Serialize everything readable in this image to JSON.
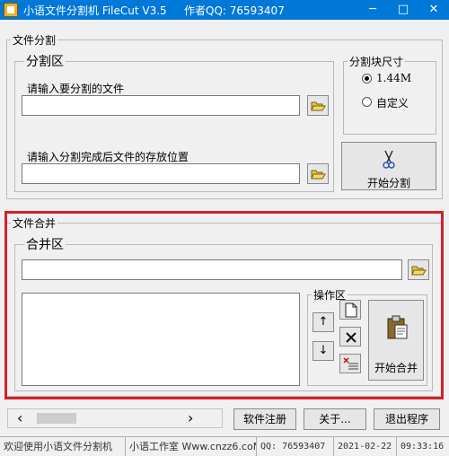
{
  "window": {
    "title": "小语文件分割机 FileCut V3.5",
    "author": "作者QQ: 76593407",
    "minimize_glyph": "─",
    "maximize_glyph": "□",
    "close_glyph": "✕"
  },
  "split": {
    "legend": "文件分割",
    "area_legend": "分割区",
    "source_label": "请输入要分割的文件",
    "source_value": "",
    "dest_label": "请输入分割完成后文件的存放位置",
    "dest_value": "",
    "size_legend": "分割块尺寸",
    "size_options": [
      "1.44M",
      "自定义"
    ],
    "size_selected": "1.44M",
    "start_label": "开始分割"
  },
  "merge": {
    "legend": "文件合并",
    "area_legend": "合并区",
    "path_value": "",
    "ops_legend": "操作区",
    "up_glyph": "↑",
    "down_glyph": "↓",
    "start_label": "开始合并"
  },
  "buttons": {
    "register": "软件注册",
    "about": "关于...",
    "exit": "退出程序"
  },
  "scrollbar": {
    "left_glyph": "‹",
    "right_glyph": "›"
  },
  "status": {
    "welcome": "欢迎使用小语文件分割机",
    "studio": "小语工作室 Www.cnzz6.coM",
    "qq": "QQ: 76593407",
    "date": "2021-02-22",
    "time": "09:33:16"
  },
  "colors": {
    "titlebar": "#0078d7",
    "highlight_frame": "#d6202a"
  }
}
